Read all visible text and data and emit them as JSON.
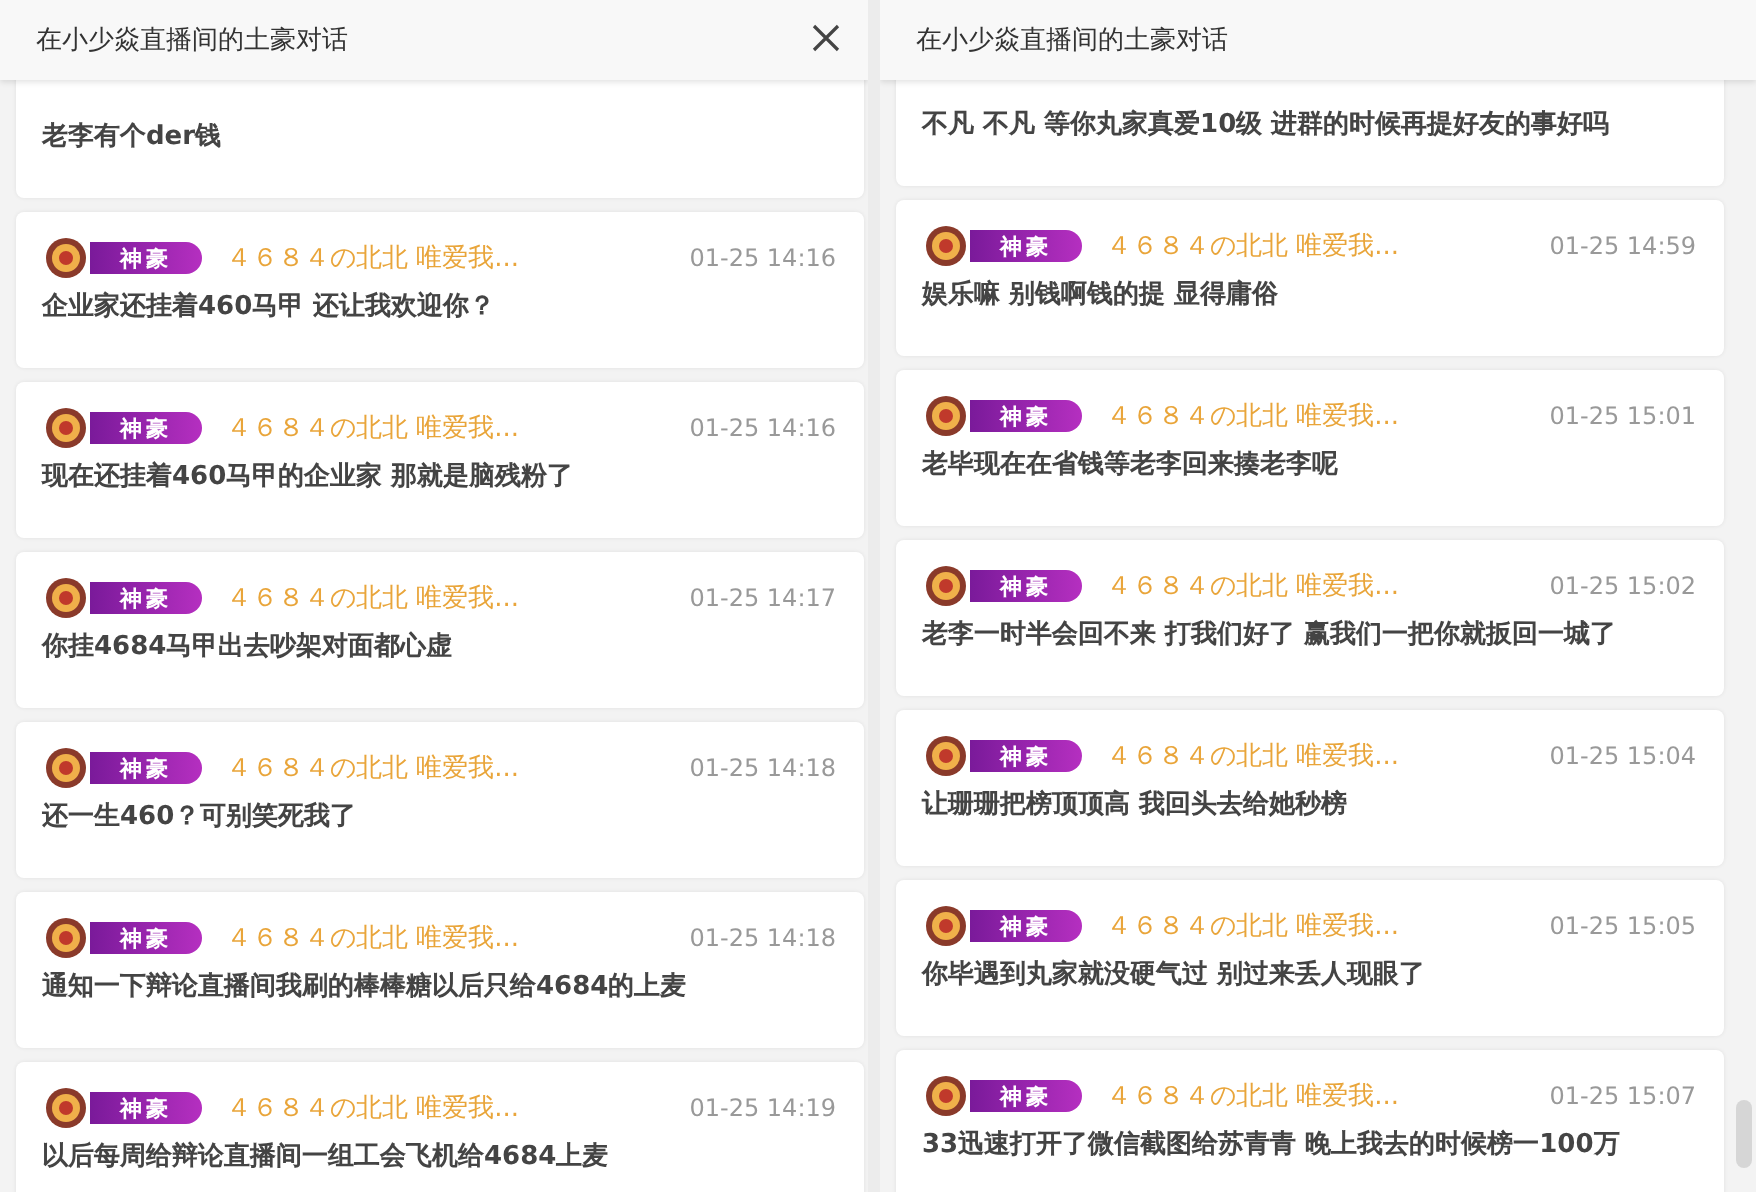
{
  "panels": [
    {
      "title": "在小少焱直播间的土豪对话",
      "closable": true,
      "messages": [
        {
          "text": "老李有个der钱"
        },
        {
          "badge": "神豪",
          "user": "４６８４の北北 唯爱我...",
          "time": "01-25 14:16",
          "text": "企业家还挂着460马甲 还让我欢迎你？"
        },
        {
          "badge": "神豪",
          "user": "４６８４の北北 唯爱我...",
          "time": "01-25 14:16",
          "text": "现在还挂着460马甲的企业家 那就是脑残粉了"
        },
        {
          "badge": "神豪",
          "user": "４６８４の北北 唯爱我...",
          "time": "01-25 14:17",
          "text": "你挂4684马甲出去吵架对面都心虚"
        },
        {
          "badge": "神豪",
          "user": "４６８４の北北 唯爱我...",
          "time": "01-25 14:18",
          "text": "还一生460？可别笑死我了"
        },
        {
          "badge": "神豪",
          "user": "４６８４の北北 唯爱我...",
          "time": "01-25 14:18",
          "text": "通知一下辩论直播间我刷的棒棒糖以后只给4684的上麦"
        },
        {
          "badge": "神豪",
          "user": "４６８４の北北 唯爱我...",
          "time": "01-25 14:19",
          "text": "以后每周给辩论直播间一组工会飞机给4684上麦"
        }
      ]
    },
    {
      "title": "在小少焱直播间的土豪对话",
      "closable": false,
      "messages": [
        {
          "text": "不凡 不凡 等你丸家真爱10级 进群的时候再提好友的事好吗"
        },
        {
          "badge": "神豪",
          "user": "４６８４の北北 唯爱我...",
          "time": "01-25 14:59",
          "text": "娱乐嘛 别钱啊钱的提 显得庸俗"
        },
        {
          "badge": "神豪",
          "user": "４６８４の北北 唯爱我...",
          "time": "01-25 15:01",
          "text": "老毕现在在省钱等老李回来揍老李呢"
        },
        {
          "badge": "神豪",
          "user": "４６８４の北北 唯爱我...",
          "time": "01-25 15:02",
          "text": "老李一时半会回不来 打我们好了 赢我们一把你就扳回一城了"
        },
        {
          "badge": "神豪",
          "user": "４６８４の北北 唯爱我...",
          "time": "01-25 15:04",
          "text": "让珊珊把榜顶顶高 我回头去给她秒榜"
        },
        {
          "badge": "神豪",
          "user": "４６８４の北北 唯爱我...",
          "time": "01-25 15:05",
          "text": "你毕遇到丸家就没硬气过 别过来丢人现眼了"
        },
        {
          "badge": "神豪",
          "user": "４６８４の北北 唯爱我...",
          "time": "01-25 15:07",
          "text": "33迅速打开了微信截图给苏青青 晚上我去的时候榜一100万"
        }
      ]
    }
  ]
}
